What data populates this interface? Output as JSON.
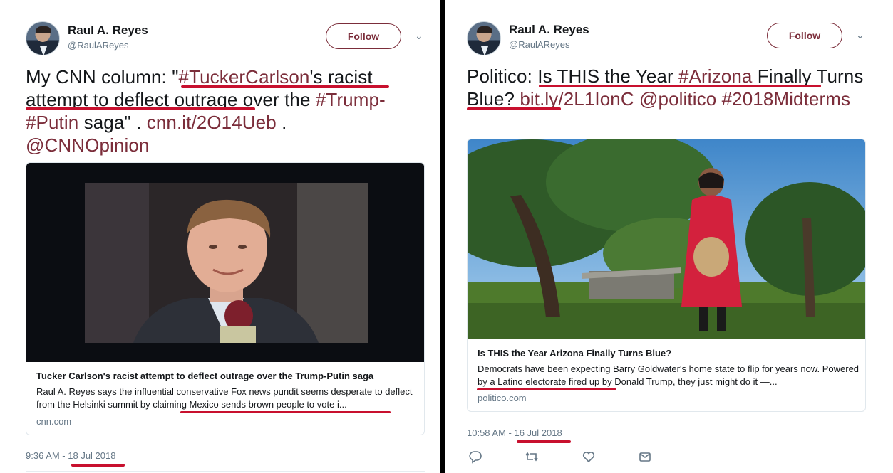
{
  "left": {
    "author": {
      "name": "Raul A. Reyes",
      "handle": "@RaulAReyes"
    },
    "follow_label": "Follow",
    "text": {
      "t1": "My CNN column: \"",
      "hashtag1": "#TuckerCarlson",
      "t2": "'s racist attempt to deflect outrage over the ",
      "hashtag2": "#Trump-",
      "hashtag3": "#Putin",
      "t3": " saga\" .  ",
      "link": "cnn.it/2O14Ueb",
      "t4": " . ",
      "mention": "@CNNOpinion"
    },
    "card": {
      "title": "Tucker Carlson's racist attempt to deflect outrage over the Trump-Putin saga",
      "description": "Raul A. Reyes says the influential conservative Fox news pundit seems desperate to deflect from the Helsinki summit by claiming Mexico sends brown people to vote i...",
      "domain": "cnn.com"
    },
    "timestamp": "9:36 AM - 18 Jul 2018"
  },
  "right": {
    "author": {
      "name": "Raul A. Reyes",
      "handle": "@RaulAReyes"
    },
    "follow_label": "Follow",
    "text": {
      "t1": "Politico: Is THIS the Year ",
      "hashtag1": "#Arizona",
      "t2": " Finally Turns Blue? ",
      "link": "bit.ly/2L1IonC",
      "t3": "  ",
      "mention": "@politico",
      "t4": " ",
      "hashtag2": "#2018Midterms"
    },
    "card": {
      "title": "Is THIS the Year Arizona Finally Turns Blue?",
      "description": "Democrats have been expecting Barry Goldwater's home state to flip for years now. Powered by a Latino electorate fired up by Donald Trump, they just might do it —...",
      "domain": "politico.com"
    },
    "timestamp": "10:58 AM - 16 Jul 2018",
    "actions": [
      "reply-icon",
      "retweet-icon",
      "like-icon",
      "message-icon"
    ]
  },
  "colors": {
    "link": "#7b2d3a",
    "underline": "#c8102e",
    "muted": "#657786"
  }
}
